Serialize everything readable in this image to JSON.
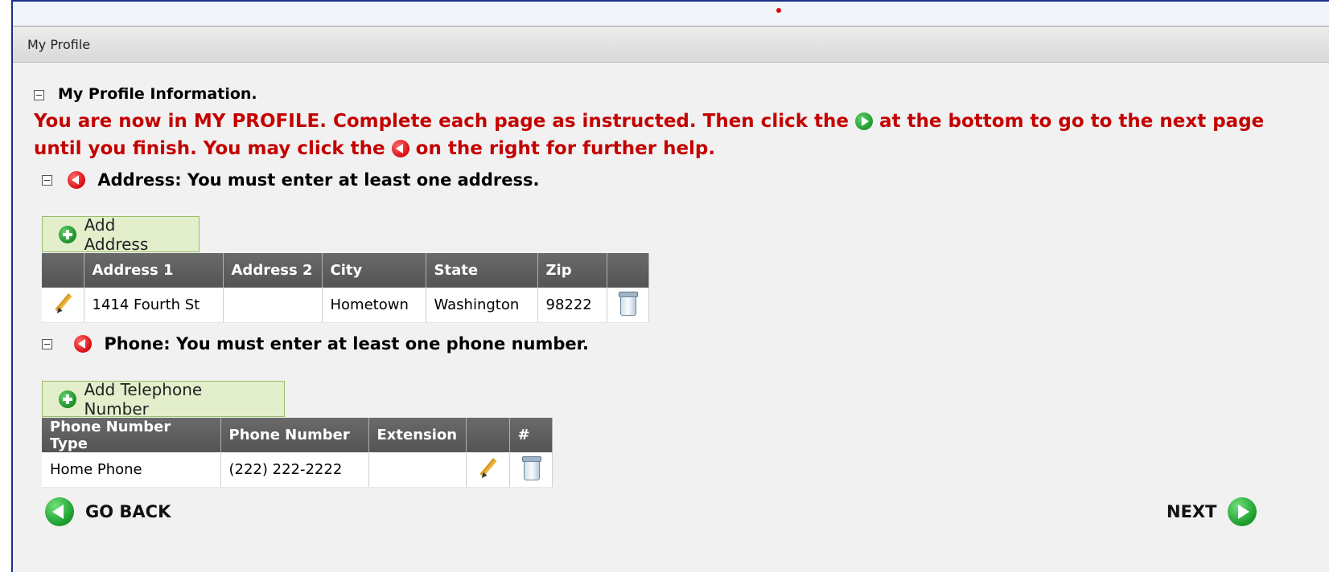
{
  "panel": {
    "title": "My Profile"
  },
  "profile": {
    "heading": "My Profile Information.",
    "instructions": {
      "part1": "You are now in MY PROFILE. Complete each page as instructed. Then click the",
      "part2": "at the bottom to go to the next page until you finish. You may click the",
      "part3": "on the right for further help."
    }
  },
  "address": {
    "heading": "Address: You must enter at least one address.",
    "add_label": "Add Address",
    "columns": [
      "",
      "Address 1",
      "Address 2",
      "City",
      "State",
      "Zip",
      ""
    ],
    "rows": [
      {
        "address1": "1414 Fourth St",
        "address2": "",
        "city": "Hometown",
        "state": "Washington",
        "zip": "98222"
      }
    ]
  },
  "phone": {
    "heading": "Phone: You must enter at least one phone number.",
    "add_label": "Add Telephone Number",
    "columns": [
      "Phone Number Type",
      "Phone Number",
      "Extension",
      "",
      "#"
    ],
    "rows": [
      {
        "type": "Home Phone",
        "number": "(222) 222-2222",
        "extension": ""
      }
    ]
  },
  "nav": {
    "back_label": "GO BACK",
    "next_label": "NEXT"
  },
  "colors": {
    "instruction_red": "#c40000",
    "header_gray": "#5a5a5a",
    "add_button_bg": "#e3eecb",
    "nav_green": "#1b9b2b",
    "frame_blue": "#1b2f8a"
  },
  "icons": {
    "help": "red-back-circle-icon",
    "next_inline": "green-play-icon",
    "add": "green-plus-icon",
    "edit": "pencil-icon",
    "delete": "trash-icon"
  }
}
